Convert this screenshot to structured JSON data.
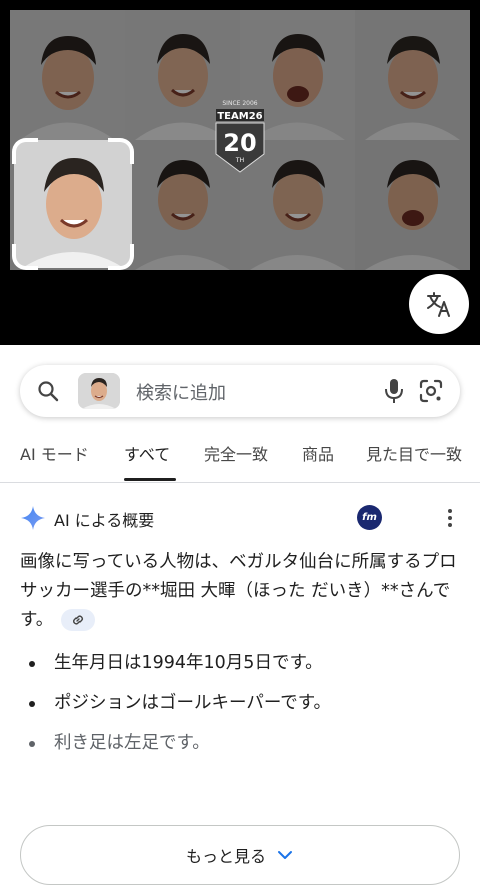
{
  "viewer": {
    "logo_top": "SINCE 2006",
    "logo_team": "TEAM26",
    "logo_number": "20",
    "logo_suffix": "TH"
  },
  "search": {
    "placeholder": "検索に追加"
  },
  "tabs": [
    {
      "label": "AI モード"
    },
    {
      "label": "すべて"
    },
    {
      "label": "完全一致"
    },
    {
      "label": "商品"
    },
    {
      "label": "見た目で一致"
    }
  ],
  "ai_overview": {
    "title": "AI による概要",
    "source_logo": "fm",
    "summary": "画像に写っている人物は、ベガルタ仙台に所属するプロサッカー選手の**堀田 大暉（ほった だいき）**さんです。",
    "bullets": [
      "生年月日は1994年10月5日です。",
      "ポジションはゴールキーパーです。",
      "利き足は左足です。"
    ],
    "more_button": "もっと見る"
  },
  "colors": {
    "accent_blue": "#4285f4",
    "source_logo_bg": "#1a2870",
    "link_chip_bg": "#e8eef9"
  }
}
